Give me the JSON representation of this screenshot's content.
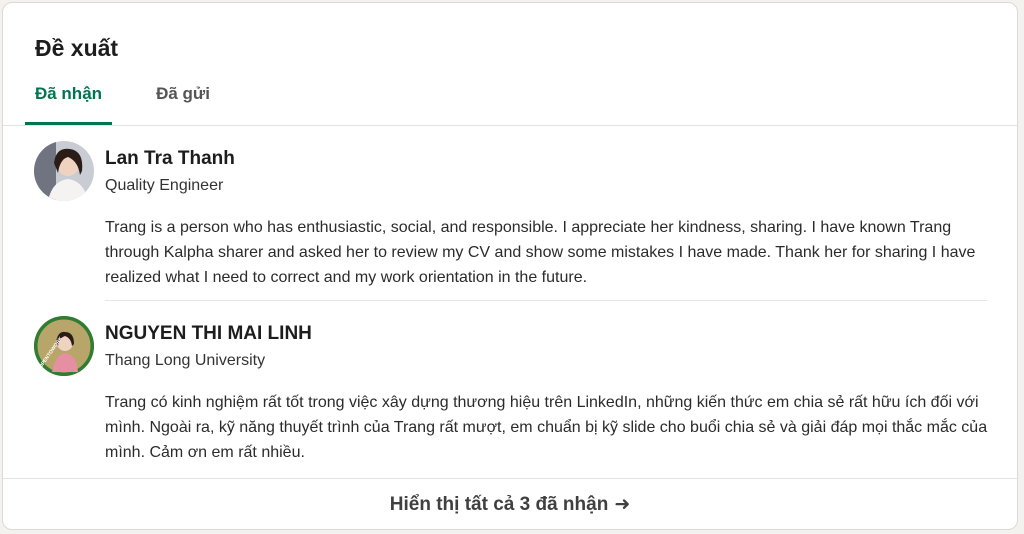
{
  "header": {
    "title": "Đề xuất"
  },
  "tabs": [
    {
      "label": "Đã nhận",
      "active": true
    },
    {
      "label": "Đã gửi",
      "active": false
    }
  ],
  "recommendations": [
    {
      "name": "Lan Tra Thanh",
      "subtitle": "Quality Engineer",
      "text": "Trang is a person who has enthusiastic, social, and responsible. I appreciate her kindness, sharing. I have known Trang through Kalpha sharer and asked her to review my CV and show some mistakes I have made. Thank her for sharing I have realized what I need to correct and my work orientation in the future."
    },
    {
      "name": "NGUYEN THI MAI LINH",
      "subtitle": "Thang Long University",
      "badge_text": "#OPENTOWORK",
      "text": "Trang có kinh nghiệm rất tốt trong việc xây dựng thương hiệu trên LinkedIn, những kiến thức em chia sẻ rất hữu ích đối với mình. Ngoài ra, kỹ năng thuyết trình của Trang rất mượt, em chuẩn bị kỹ slide cho buổi chia sẻ và giải đáp mọi thắc mắc của mình. Cảm ơn em rất nhiều."
    }
  ],
  "footer": {
    "label": "Hiển thị tất cả 3 đã nhận",
    "arrow_icon": "arrow-right-icon"
  },
  "colors": {
    "accent": "#01754f",
    "open_to_work": "#2f7d32"
  }
}
